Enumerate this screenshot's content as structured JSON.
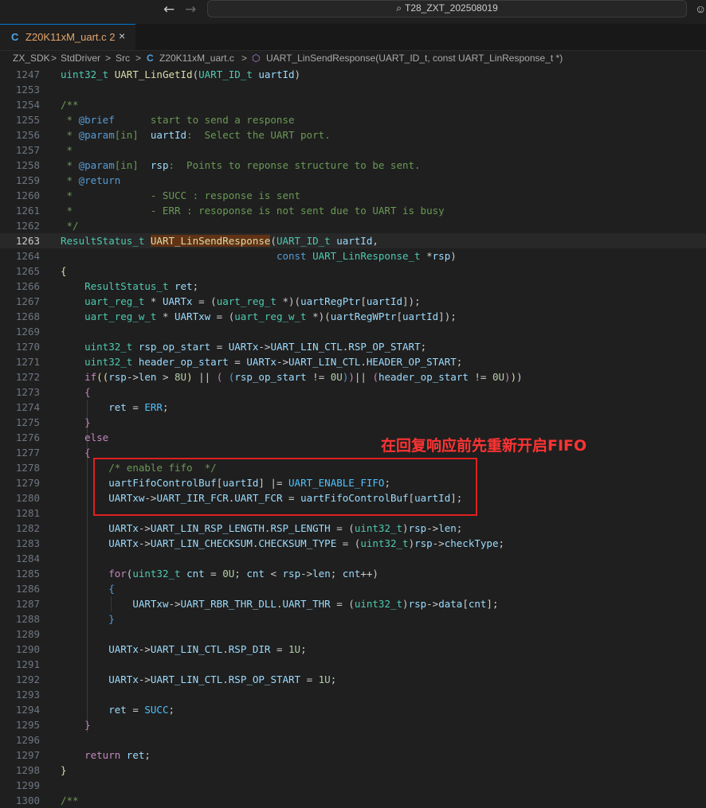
{
  "titlebar": {
    "back_icon": "arrow-left-icon",
    "forward_icon": "arrow-right-icon",
    "search_text": "T28_ZXT_202508019",
    "search_icon": "search-icon",
    "copilot_icon": "copilot-icon"
  },
  "tab": {
    "lang": "C",
    "label": "Z20K11xM_uart.c 2",
    "close": "×"
  },
  "breadcrumb": {
    "items": [
      "ZX_SDK",
      "StdDriver",
      "Src",
      "C",
      "Z20K11xM_uart.c",
      "UART_LinSendResponse(UART_ID_t, const UART_LinResponse_t *)"
    ],
    "separator": ">"
  },
  "annotation": {
    "text": "在回复响应前先重新开启FIFO",
    "color": "#ff3333"
  },
  "editor": {
    "sticky_line_number": "1247",
    "current_line": "1263",
    "lines": [
      {
        "n": "1247",
        "html": "<span class=\"ty\">uint32_t</span> <span class=\"fn\">UART_LinGetId</span>(<span class=\"ty\">UART_ID_t</span> <span class=\"var\">uartId</span>)"
      },
      {
        "n": "1253",
        "html": ""
      },
      {
        "n": "1254",
        "html": "<span class=\"cm\">/**</span>"
      },
      {
        "n": "1255",
        "html": "<span class=\"cm\"> * </span><span class=\"kw\">@brief</span><span class=\"cm\">      start to send a response</span>"
      },
      {
        "n": "1256",
        "html": "<span class=\"cm\"> * </span><span class=\"kw\">@param</span><span class=\"cm\">[in]  </span><span class=\"var\">uartId</span><span class=\"cm\">:  Select the UART port.</span>"
      },
      {
        "n": "1257",
        "html": "<span class=\"cm\"> *</span>"
      },
      {
        "n": "1258",
        "html": "<span class=\"cm\"> * </span><span class=\"kw\">@param</span><span class=\"cm\">[in]  </span><span class=\"var\">rsp</span><span class=\"cm\">:  Points to reponse structure to be sent.</span>"
      },
      {
        "n": "1259",
        "html": "<span class=\"cm\"> * </span><span class=\"kw\">@return</span>"
      },
      {
        "n": "1260",
        "html": "<span class=\"cm\"> *             - SUCC : response is sent</span>"
      },
      {
        "n": "1261",
        "html": "<span class=\"cm\"> *             - ERR : resoponse is not sent due to UART is busy</span>"
      },
      {
        "n": "1262",
        "html": "<span class=\"cm\"> */</span>"
      },
      {
        "n": "1263",
        "html": "<span class=\"ty\">ResultStatus_t</span> <span class=\"fn hl\">UART_LinSendResponse</span>(<span class=\"ty\">UART_ID_t</span> <span class=\"var\">uartId</span>,",
        "current": true
      },
      {
        "n": "1264",
        "html": "                                    <span class=\"kw\">const</span> <span class=\"ty\">UART_LinResponse_t</span> *<span class=\"var\">rsp</span>)"
      },
      {
        "n": "1265",
        "html": "<span class=\"fn\">{</span>"
      },
      {
        "n": "1266",
        "html": "    <span class=\"ty\">ResultStatus_t</span> <span class=\"var\">ret</span>;"
      },
      {
        "n": "1267",
        "html": "    <span class=\"ty\">uart_reg_t</span> * <span class=\"var\">UARTx</span> = (<span class=\"ty\">uart_reg_t</span> *)(<span class=\"var\">uartRegPtr</span>[<span class=\"var\">uartId</span>]);"
      },
      {
        "n": "1268",
        "html": "    <span class=\"ty\">uart_reg_w_t</span> * <span class=\"var\">UARTxw</span> = (<span class=\"ty\">uart_reg_w_t</span> *)(<span class=\"var\">uartRegWPtr</span>[<span class=\"var\">uartId</span>]);"
      },
      {
        "n": "1269",
        "html": ""
      },
      {
        "n": "1270",
        "html": "    <span class=\"ty\">uint32_t</span> <span class=\"var\">rsp_op_start</span> = <span class=\"var\">UARTx</span>-><span class=\"var\">UART_LIN_CTL</span>.<span class=\"var\">RSP_OP_START</span>;"
      },
      {
        "n": "1271",
        "html": "    <span class=\"ty\">uint32_t</span> <span class=\"var\">header_op_start</span> = <span class=\"var\">UARTx</span>-><span class=\"var\">UART_LIN_CTL</span>.<span class=\"var\">HEADER_OP_START</span>;"
      },
      {
        "n": "1272",
        "html": "    <span class=\"ctrl\">if</span><span class=\"fn\">((</span><span class=\"var\">rsp</span>-><span class=\"var\">len</span> > <span class=\"num\">8U</span><span class=\"fn\">)</span> || <span class=\"ctrl\">(</span> <span class=\"kw\">(</span><span class=\"var\">rsp_op_start</span> != <span class=\"num\">0U</span><span class=\"kw\">)</span><span class=\"ctrl\">)</span>|| <span class=\"ctrl\">(</span><span class=\"var\">header_op_start</span> != <span class=\"num\">0U</span><span class=\"ctrl\">)</span><span class=\"fn\">)</span>)"
      },
      {
        "n": "1273",
        "html": "    <span class=\"ctrl\">{</span>"
      },
      {
        "n": "1274",
        "html": "        <span class=\"var\">ret</span> = <span class=\"mac\">ERR</span>;"
      },
      {
        "n": "1275",
        "html": "    <span class=\"ctrl\">}</span>"
      },
      {
        "n": "1276",
        "html": "    <span class=\"ctrl\">else</span>"
      },
      {
        "n": "1277",
        "html": "    <span class=\"ctrl\">{</span>"
      },
      {
        "n": "1278",
        "html": "        <span class=\"cm\">/* enable fifo  */</span>"
      },
      {
        "n": "1279",
        "html": "        <span class=\"var\">uartFifoControlBuf</span>[<span class=\"var\">uartId</span>] |= <span class=\"mac\">UART_ENABLE_FIFO</span>;"
      },
      {
        "n": "1280",
        "html": "        <span class=\"var\">UARTxw</span>-><span class=\"var\">UART_IIR_FCR</span>.<span class=\"var\">UART_FCR</span> = <span class=\"var\">uartFifoControlBuf</span>[<span class=\"var\">uartId</span>];"
      },
      {
        "n": "1281",
        "html": ""
      },
      {
        "n": "1282",
        "html": "        <span class=\"var\">UARTx</span>-><span class=\"var\">UART_LIN_RSP_LENGTH</span>.<span class=\"var\">RSP_LENGTH</span> = (<span class=\"ty\">uint32_t</span>)<span class=\"var\">rsp</span>-><span class=\"var\">len</span>;"
      },
      {
        "n": "1283",
        "html": "        <span class=\"var\">UARTx</span>-><span class=\"var\">UART_LIN_CHECKSUM</span>.<span class=\"var\">CHECKSUM_TYPE</span> = (<span class=\"ty\">uint32_t</span>)<span class=\"var\">rsp</span>-><span class=\"var\">checkType</span>;"
      },
      {
        "n": "1284",
        "html": ""
      },
      {
        "n": "1285",
        "html": "        <span class=\"ctrl\">for</span>(<span class=\"ty\">uint32_t</span> <span class=\"var\">cnt</span> = <span class=\"num\">0U</span>; <span class=\"var\">cnt</span> < <span class=\"var\">rsp</span>-><span class=\"var\">len</span>; <span class=\"var\">cnt</span>++)"
      },
      {
        "n": "1286",
        "html": "        <span class=\"kw\">{</span>"
      },
      {
        "n": "1287",
        "html": "            <span class=\"var\">UARTxw</span>-><span class=\"var\">UART_RBR_THR_DLL</span>.<span class=\"var\">UART_THR</span> = (<span class=\"ty\">uint32_t</span>)<span class=\"var\">rsp</span>-><span class=\"var\">data</span>[<span class=\"var\">cnt</span>];"
      },
      {
        "n": "1288",
        "html": "        <span class=\"kw\">}</span>"
      },
      {
        "n": "1289",
        "html": ""
      },
      {
        "n": "1290",
        "html": "        <span class=\"var\">UARTx</span>-><span class=\"var\">UART_LIN_CTL</span>.<span class=\"var\">RSP_DIR</span> = <span class=\"num\">1U</span>;"
      },
      {
        "n": "1291",
        "html": ""
      },
      {
        "n": "1292",
        "html": "        <span class=\"var\">UARTx</span>-><span class=\"var\">UART_LIN_CTL</span>.<span class=\"var\">RSP_OP_START</span> = <span class=\"num\">1U</span>;"
      },
      {
        "n": "1293",
        "html": ""
      },
      {
        "n": "1294",
        "html": "        <span class=\"var\">ret</span> = <span class=\"mac\">SUCC</span>;"
      },
      {
        "n": "1295",
        "html": "    <span class=\"ctrl\">}</span>"
      },
      {
        "n": "1296",
        "html": ""
      },
      {
        "n": "1297",
        "html": "    <span class=\"ctrl\">return</span> <span class=\"var\">ret</span>;"
      },
      {
        "n": "1298",
        "html": "<span class=\"fn\">}</span>"
      },
      {
        "n": "1299",
        "html": ""
      },
      {
        "n": "1300",
        "html": "<span class=\"cm\">/**</span>"
      }
    ]
  }
}
